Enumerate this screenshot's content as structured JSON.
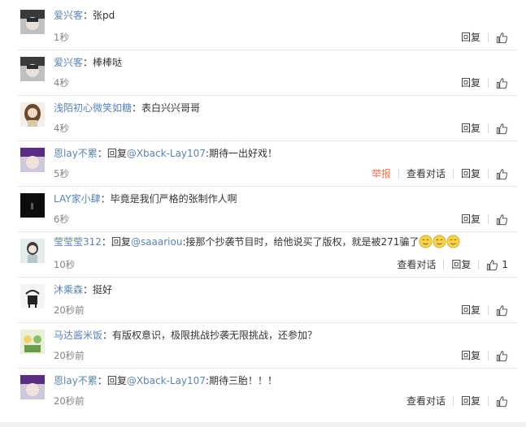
{
  "colors": {
    "name": "#eb7350",
    "link": "#5a83b5",
    "time": "#808080",
    "separator": "#e6e6e6",
    "report": "#eb7350"
  },
  "labels": {
    "reply": "回复",
    "view_conversation": "查看对话",
    "report": "举报",
    "like_icon": "thumbs-up-icon",
    "colon": "："
  },
  "comments": [
    {
      "name": "爱兴客",
      "content": "张pd",
      "time": "1秒"
    },
    {
      "name": "爱兴客",
      "content": "棒棒哒",
      "time": "4秒"
    },
    {
      "name": "浅陌初心微笑如糖",
      "content": "表白兴兴哥哥",
      "time": "4秒"
    },
    {
      "name": "恩lay不累",
      "reply_prefix": "回复",
      "mention": "@Xback-Lay107",
      "content": ":期待一出好戏！",
      "time": "5秒"
    },
    {
      "name": "LAY家小肆",
      "content": "毕竟是我们严格的张制作人啊",
      "time": "6秒"
    },
    {
      "name": "莹莹莹312",
      "reply_prefix": "回复",
      "mention": "@saaariou",
      "content": ":接那个抄袭节目时，给他说买了版权，就是被271骗了",
      "emoji": "face-emoji",
      "time": "10秒",
      "likes": "1"
    },
    {
      "name": "沐乘森",
      "content": "挺好",
      "time": "20秒前"
    },
    {
      "name": "马达酱米饭",
      "content": "有版权意识，极限挑战抄袭无限挑战，还参加？",
      "time": "20秒前"
    },
    {
      "name": "恩lay不累",
      "reply_prefix": "回复",
      "mention": "@Xback-Lay107",
      "content": ":期待三胎！！！",
      "time": "20秒前"
    }
  ]
}
